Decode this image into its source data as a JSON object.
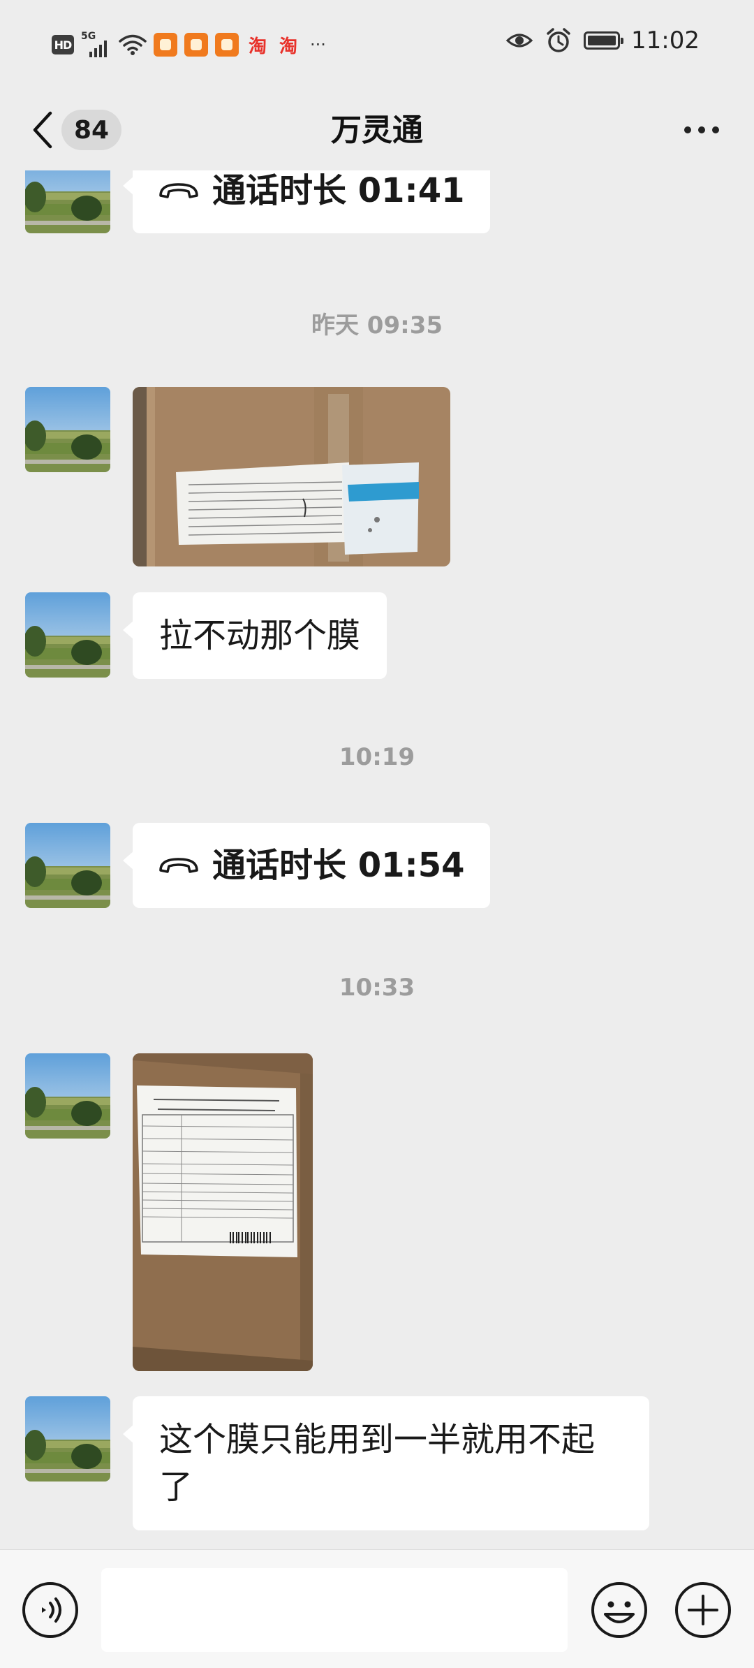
{
  "status_bar": {
    "hd": "HD",
    "network": "5G",
    "taobao_glyph": "淘",
    "more": "···",
    "time": "11:02"
  },
  "nav": {
    "unread_count": "84",
    "title": "万灵通"
  },
  "messages": [
    {
      "type": "call",
      "label": "通话时长 01:41"
    },
    {
      "type": "timestamp",
      "text": "昨天 09:35"
    },
    {
      "type": "image",
      "content": "carton-label-photo"
    },
    {
      "type": "text",
      "text": "拉不动那个膜"
    },
    {
      "type": "timestamp",
      "text": "10:19"
    },
    {
      "type": "call",
      "label": "通话时长 01:54"
    },
    {
      "type": "timestamp",
      "text": "10:33"
    },
    {
      "type": "image",
      "content": "product-certificate-photo"
    },
    {
      "type": "text",
      "text": "这个膜只能用到一半就用不起了"
    }
  ],
  "input": {
    "value": "",
    "placeholder": ""
  },
  "colors": {
    "background": "#EDEDED",
    "bubble": "#FFFFFF",
    "timestamp": "#9C9C9C",
    "input_bar": "#F7F7F7"
  },
  "icons": {
    "back": "chevron-left-icon",
    "more": "more-dots-icon",
    "call": "phone-hangup-icon",
    "voice": "voice-icon",
    "emoji": "emoji-icon",
    "plus": "plus-icon"
  }
}
